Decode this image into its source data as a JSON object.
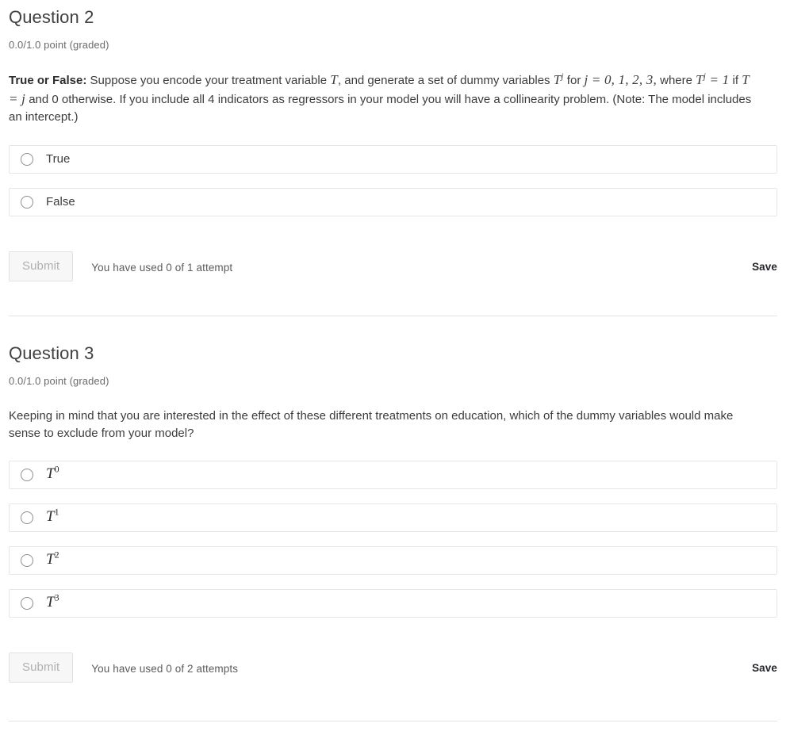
{
  "questions": [
    {
      "title": "Question 2",
      "points": "0.0/1.0 point (graded)",
      "prompt": {
        "lead": "True or False:",
        "seg1": " Suppose you encode your treatment variable ",
        "math1_base": "T",
        "seg2": ", and generate a set of dummy variables ",
        "math2_base": "T",
        "math2_sup": "j",
        "seg3": " for ",
        "math3": "j = 0, 1, 2, 3,",
        "seg4": " where ",
        "math4_base": "T",
        "math4_sup": "j",
        "math4_rest": " = 1",
        "seg5": " if ",
        "math5": "T = j",
        "seg6": " and 0 otherwise. If you include all 4 indicators as regressors in your model you will have a collinearity problem. (Note: The model includes an intercept.)"
      },
      "options": [
        {
          "label": "True",
          "type": "text"
        },
        {
          "label": "False",
          "type": "text"
        }
      ],
      "submit_label": "Submit",
      "attempts_text": "You have used 0 of 1 attempt",
      "save_label": "Save"
    },
    {
      "title": "Question 3",
      "points": "0.0/1.0 point (graded)",
      "prompt_text": "Keeping in mind that you are interested in the effect of these different treatments on education, which of the dummy variables would make sense to exclude from your model?",
      "options": [
        {
          "label": "T",
          "sup": "0",
          "type": "math"
        },
        {
          "label": "T",
          "sup": "1",
          "type": "math"
        },
        {
          "label": "T",
          "sup": "2",
          "type": "math"
        },
        {
          "label": "T",
          "sup": "3",
          "type": "math"
        }
      ],
      "submit_label": "Submit",
      "attempts_text": "You have used 0 of 2 attempts",
      "save_label": "Save"
    }
  ],
  "colors": {
    "text": "#3c3c3c",
    "heading": "#414141",
    "muted": "#6b6b6b",
    "border": "#e6e6e6",
    "divider": "#e3e3e3",
    "disabled_btn_bg": "#f7f7f7",
    "disabled_btn_text": "#b0b0b0"
  }
}
